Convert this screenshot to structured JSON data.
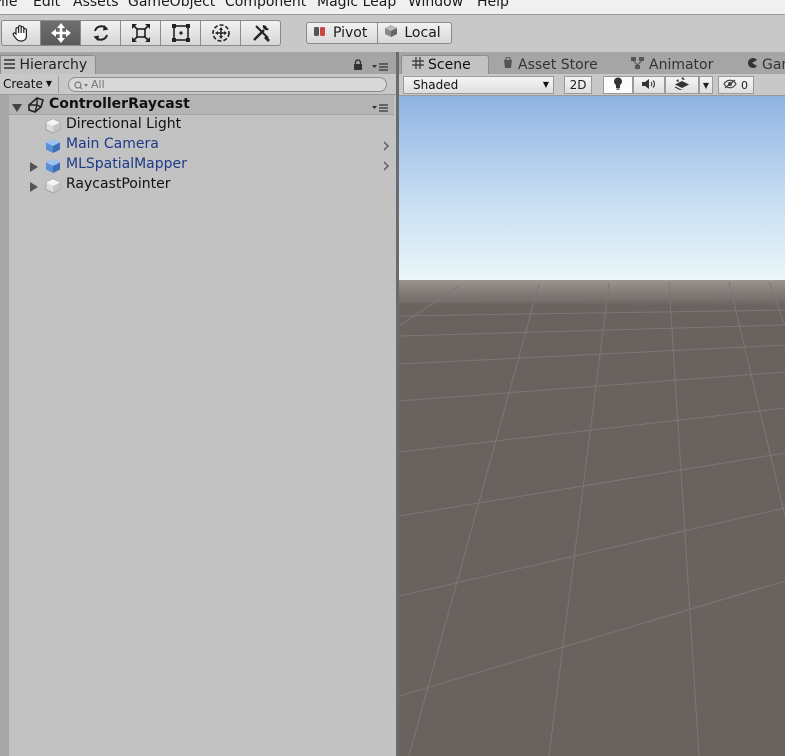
{
  "menu": [
    "File",
    "Edit",
    "Assets",
    "GameObject",
    "Component",
    "Magic Leap",
    "Window",
    "Help"
  ],
  "toolbar": {
    "tools": [
      {
        "name": "hand-tool",
        "icon": "hand-icon"
      },
      {
        "name": "move-tool",
        "icon": "move-arrows-icon",
        "active": true
      },
      {
        "name": "rotate-tool",
        "icon": "rotate-icon"
      },
      {
        "name": "scale-tool",
        "icon": "scale-icon"
      },
      {
        "name": "rect-tool",
        "icon": "rect-icon"
      },
      {
        "name": "transform-tool",
        "icon": "transform-icon"
      },
      {
        "name": "custom-tool",
        "icon": "tools-icon"
      }
    ],
    "pivot_label": "Pivot",
    "local_label": "Local"
  },
  "hierarchy": {
    "tab_label": "Hierarchy",
    "create_label": "Create",
    "search_placeholder": "All",
    "scene_name": "ControllerRaycast",
    "items": [
      {
        "label": "Directional Light",
        "prefab": false,
        "expandable": false
      },
      {
        "label": "Main Camera",
        "prefab": true,
        "expandable": false,
        "has_child_arrow": true
      },
      {
        "label": "MLSpatialMapper",
        "prefab": true,
        "expandable": true,
        "has_child_arrow": true
      },
      {
        "label": "RaycastPointer",
        "prefab": false,
        "expandable": true
      }
    ]
  },
  "scene": {
    "tabs": [
      {
        "label": "Scene",
        "icon": "grid-icon",
        "active": true
      },
      {
        "label": "Asset Store",
        "icon": "store-icon"
      },
      {
        "label": "Animator",
        "icon": "animator-icon"
      },
      {
        "label": "Game",
        "icon": "game-icon"
      }
    ],
    "shading_mode": "Shaded",
    "toggle_2d": "2D",
    "hidden_count": "0"
  },
  "colors": {
    "sky_top": "#8fb3e2",
    "horizon": "#eaf6f8",
    "ground": "#6a625f",
    "prefab_text": "#1b3a86"
  }
}
